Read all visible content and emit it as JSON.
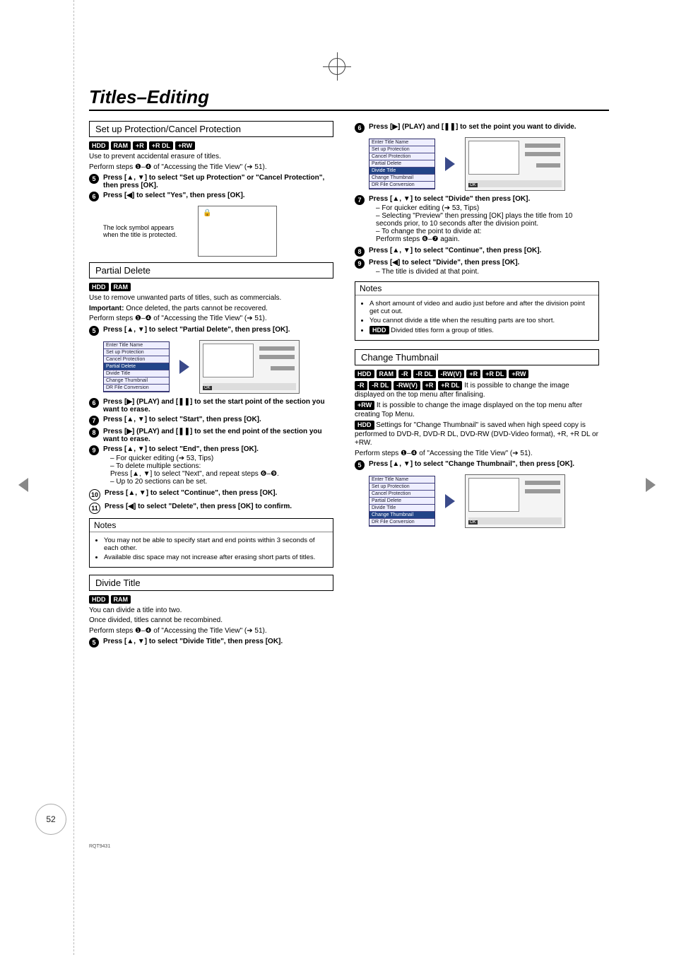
{
  "doc": {
    "section_title": "Titles–Editing",
    "page_number": "52",
    "footer_code": "RQT9431"
  },
  "protection": {
    "heading": "Set up Protection/Cancel Protection",
    "badges": [
      "HDD",
      "RAM",
      "+R",
      "+R DL",
      "+RW"
    ],
    "use": "Use to prevent accidental erasure of titles.",
    "perform": "Perform steps ❶–❹ of \"Accessing the Title View\" (➔ 51).",
    "step5": "Press [▲, ▼] to select \"Set up Protection\" or \"Cancel Protection\", then press [OK].",
    "step6": "Press [◀] to select \"Yes\", then press [OK].",
    "lock_text": "The lock symbol appears when the title is protected."
  },
  "partial": {
    "heading": "Partial Delete",
    "badges": [
      "HDD",
      "RAM"
    ],
    "use": "Use to remove unwanted parts of titles, such as commercials.",
    "important_label": "Important:",
    "important": " Once deleted, the parts cannot be recovered.",
    "perform": "Perform steps ❶–❹ of \"Accessing the Title View\" (➔ 51).",
    "step5": "Press [▲, ▼] to select \"Partial Delete\", then press [OK].",
    "step6": "Press [▶] (PLAY) and [❚❚] to set the start point of the section you want to erase.",
    "step7": "Press [▲, ▼] to select \"Start\", then press [OK].",
    "step8": "Press [▶] (PLAY) and [❚❚] to set the end point of the section you want to erase.",
    "step9": "Press [▲, ▼] to select \"End\", then press [OK].",
    "step9_sub1": "For quicker editing (➔ 53, Tips)",
    "step9_sub2": "To delete multiple sections:",
    "step9_sub2b": "Press [▲, ▼] to select \"Next\", and repeat steps ❻–❾.",
    "step9_sub3": "Up to 20 sections can be set.",
    "step10": "Press [▲, ▼] to select \"Continue\", then press [OK].",
    "step11": "Press [◀] to select \"Delete\", then press [OK] to confirm.",
    "notes_title": "Notes",
    "note1": "You may not be able to specify start and end points within 3 seconds of each other.",
    "note2": "Available disc space may not increase after erasing short parts of titles."
  },
  "divide": {
    "heading": "Divide Title",
    "badges": [
      "HDD",
      "RAM"
    ],
    "line1": "You can divide a title into two.",
    "line2": "Once divided, titles cannot be recombined.",
    "perform": "Perform steps ❶–❹ of \"Accessing the Title View\" (➔ 51).",
    "step5": "Press [▲, ▼] to select \"Divide Title\", then press [OK].",
    "step6": "Press [▶] (PLAY) and [❚❚] to set the point you want to divide.",
    "step7": "Press [▲, ▼] to select \"Divide\" then press [OK].",
    "step7_sub1": "For quicker editing (➔ 53, Tips)",
    "step7_sub2": "Selecting \"Preview\" then pressing [OK] plays the title from 10 seconds prior, to 10 seconds after the division point.",
    "step7_sub3": "To change the point to divide at:",
    "step7_sub3b": "Perform steps ❻–❼ again.",
    "step8": "Press [▲, ▼] to select \"Continue\", then press [OK].",
    "step9": "Press [◀] to select \"Divide\", then press [OK].",
    "step9_sub": "The title is divided at that point.",
    "notes_title": "Notes",
    "note1": "A short amount of video and audio just before and after the division point get cut out.",
    "note2": "You cannot divide a title when the resulting parts are too short.",
    "note3_badge": "HDD",
    "note3": " Divided titles form a group of titles."
  },
  "thumb": {
    "heading": "Change Thumbnail",
    "badges": [
      "HDD",
      "RAM",
      "-R",
      "-R DL",
      "-RW(V)",
      "+R",
      "+R DL",
      "+RW"
    ],
    "line1_badges": [
      "-R",
      "-R DL",
      "-RW(V)",
      "+R",
      "+R DL"
    ],
    "line1": " It is possible to change the image displayed on the top menu after finalising.",
    "line2_badge": "+RW",
    "line2": " It is possible to change the image displayed on the top menu after creating Top Menu.",
    "line3_badge": "HDD",
    "line3": " Settings for \"Change Thumbnail\" is saved when high speed copy is performed to DVD-R, DVD-R DL, DVD-RW (DVD-Video format), +R, +R DL or +RW.",
    "perform": "Perform steps ❶–❹ of \"Accessing the Title View\" (➔ 51).",
    "step5": "Press [▲, ▼] to select \"Change Thumbnail\", then press [OK]."
  },
  "menu_items": {
    "i0": "Enter Title Name",
    "i1": "Set up Protection",
    "i2": "Cancel Protection",
    "i3": "Partial Delete",
    "i4": "Divide Title",
    "i5": "Change Thumbnail",
    "i6": "DR File Conversion"
  }
}
